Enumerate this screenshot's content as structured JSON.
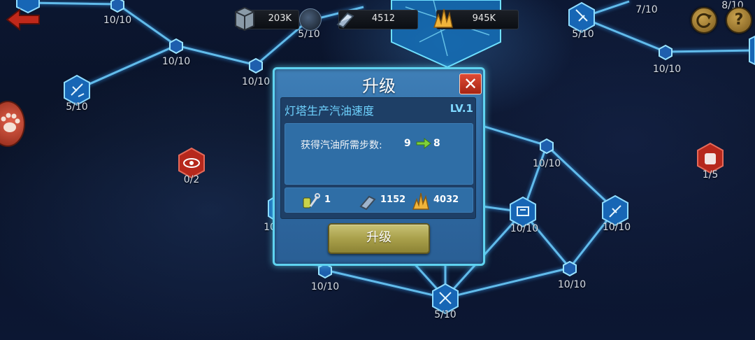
{
  "resources": [
    {
      "icon": "crate-icon",
      "value": "203K"
    },
    {
      "icon": "steel-icon",
      "value": "4512"
    },
    {
      "icon": "crystal-icon",
      "value": "945K"
    }
  ],
  "nodes": [
    {
      "label": "10/10"
    },
    {
      "label": "10/10"
    },
    {
      "label": "10/10"
    },
    {
      "label": "5/10"
    },
    {
      "label": "5/10"
    },
    {
      "label": "0/2"
    },
    {
      "label": "7/10"
    },
    {
      "label": "8/10"
    },
    {
      "label": "5/10"
    },
    {
      "label": "10/10"
    },
    {
      "label": "1/5"
    },
    {
      "label": "10/10"
    },
    {
      "label": "10/10"
    },
    {
      "label": "10/10"
    },
    {
      "label": "10/10"
    },
    {
      "label": "10/10"
    },
    {
      "label": "5/10"
    },
    {
      "label": "10"
    }
  ],
  "modal": {
    "title": "升级",
    "skill_name": "灯塔生产汽油速度",
    "level": "LV.1",
    "effect_label": "获得汽油所需步数:",
    "effect_from": "9",
    "effect_to": "8",
    "costs": [
      {
        "icon": "wrench-oil-icon",
        "value": "1"
      },
      {
        "icon": "steel-icon",
        "value": "1152"
      },
      {
        "icon": "crystal-icon",
        "value": "4032"
      }
    ],
    "upgrade_label": "升级"
  }
}
